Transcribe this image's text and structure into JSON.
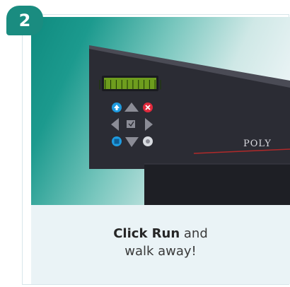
{
  "step": {
    "number": "2"
  },
  "photo": {
    "display_text": "||||||||||||",
    "brand_text": "POLY"
  },
  "caption": {
    "bold": "Click Run",
    "line1_rest": " and",
    "line2": "walk away!"
  },
  "colors": {
    "badge": "#1a8c80",
    "caption_bg": "#eaf3f6",
    "device_body": "#2a2b33",
    "lcd": "#6e9d1e"
  },
  "icons": [
    "up-arrow-blue-icon",
    "up-triangle-icon",
    "cancel-red-icon",
    "left-triangle-icon",
    "enter-icon",
    "right-triangle-icon",
    "stop-blue-icon",
    "down-triangle-icon",
    "eject-white-icon"
  ]
}
